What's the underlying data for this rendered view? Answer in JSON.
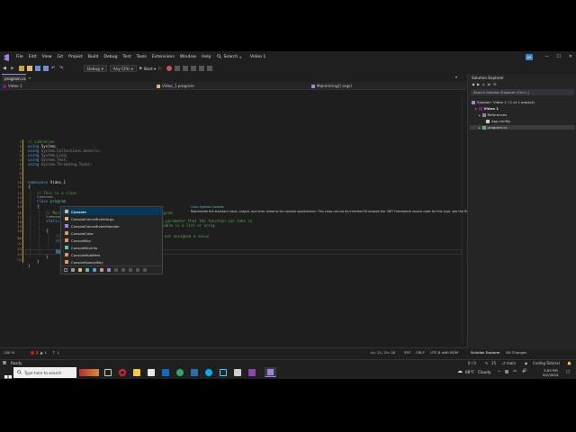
{
  "menubar": {
    "items": [
      "File",
      "Edit",
      "View",
      "Git",
      "Project",
      "Build",
      "Debug",
      "Test",
      "Tools",
      "Extensions",
      "Window",
      "Help"
    ],
    "search_label": "Search",
    "solution_name": "Video 1",
    "avatar": "AR"
  },
  "toolbar": {
    "config": "Debug",
    "platform": "Any CPU",
    "start_label": "Start"
  },
  "tabs": [
    {
      "label": "program.cs"
    }
  ],
  "navbar": {
    "project": "Video 1",
    "class": "Video_1.program",
    "member": "Main(string[] args)"
  },
  "code": {
    "lines": [
      {
        "n": "1"
      },
      {
        "n": "2"
      },
      {
        "n": "3"
      },
      {
        "n": "4"
      },
      {
        "n": "5"
      },
      {
        "n": "6"
      },
      {
        "n": "7"
      },
      {
        "n": "8"
      },
      {
        "n": "9"
      },
      {
        "n": "10"
      },
      {
        "n": "11"
      },
      {
        "n": "12"
      },
      {
        "n": "13"
      },
      {
        "n": "14"
      },
      {
        "n": "15"
      },
      {
        "n": "16"
      },
      {
        "n": "17"
      },
      {
        "n": "18"
      },
      {
        "n": "19"
      },
      {
        "n": "20"
      },
      {
        "n": "21"
      },
      {
        "n": "22"
      },
      {
        "n": "23"
      },
      {
        "n": "24"
      },
      {
        "n": "25"
      }
    ],
    "l1_comment": "// Libraries",
    "using_kw": "using",
    "ns1": "System;",
    "ns2": "System.Collections.Generic;",
    "ns3": "System.Linq;",
    "ns4": "System.Text;",
    "ns5": "System.Threading.Tasks;",
    "namespace_kw": "namespace",
    "namespace_name": "Video_1",
    "brace_open": "{",
    "brace_close": "}",
    "class_comment": "// This is a class",
    "refs0": "0 references",
    "class_kw": "class",
    "class_name": "program",
    "main_comment": "// Main method. This will run at the start of the program",
    "refs0b": "0 references",
    "static_kw": "static",
    "void_kw": "void",
    "main_name": "Main",
    "paren_open": "(",
    "string_kw": "string",
    "arr": "[]",
    "args_name": "args",
    "paren_close": ")",
    "main_trail": " // string[] args is a parameter that the function can take in",
    "main_comment2": "// [] means the variable is a list or array",
    "decl_comment": "// Declares a string variable called str that is not assigned a value",
    "string_kw2": "string",
    "str_decl": " str;",
    "typed": "Console"
  },
  "completion": {
    "items": [
      {
        "label": "Console"
      },
      {
        "label": "ConsoleCancelEventArgs"
      },
      {
        "label": "ConsoleCancelEventHandler"
      },
      {
        "label": "ConsoleColor"
      },
      {
        "label": "ConsoleKey"
      },
      {
        "label": "ConsoleKeyInfo"
      },
      {
        "label": "ConsoleModifiers"
      },
      {
        "label": "ConsoleSpecialKey"
      }
    ]
  },
  "tooltip": {
    "signature_kw": "class",
    "signature": "System.Console",
    "description": "Represents the standard input, output, and error streams for console applications. This class cannot be inherited.To browse the .NET Framework source code for this type, see the Reference Source."
  },
  "solution_explorer": {
    "title": "Solution Explorer",
    "search_placeholder": "Search Solution Explorer (Ctrl+;)",
    "solution": "Solution 'Video 1' (1 of 1 project)",
    "project": "Video 1",
    "references": "References",
    "appconfig": "App.config",
    "program": "program.cs"
  },
  "panel_tabs": {
    "tab1": "Solution Explorer",
    "tab2": "Git Changes"
  },
  "editor_status": {
    "zoom": "100 %",
    "errors": "2",
    "warnings": "1",
    "position": "Ln: 21, Ch: 20",
    "spaces": "SPC",
    "line_ending": "CRLF",
    "encoding": "UTF-8 with BOM"
  },
  "statusbar": {
    "ready": "Ready",
    "git_counts": "0 / 0",
    "pencil": "15",
    "branch": "main",
    "repo": "Coding-Tutorial"
  },
  "taskbar": {
    "search_placeholder": "Type here to search",
    "weather_temp": "68°F",
    "weather_desc": "Cloudy",
    "time": "3:05 PM",
    "date": "9/2/2024"
  },
  "colors": {
    "accent": "#a37fe0",
    "keyword": "#569cd6",
    "type": "#4ec9b0",
    "comment": "#57a64a"
  }
}
